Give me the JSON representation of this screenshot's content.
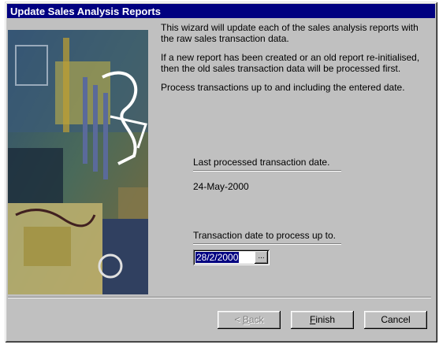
{
  "window": {
    "title": "Update Sales Analysis Reports"
  },
  "intro": {
    "paragraph_1": "This wizard will update each of the sales analysis reports with the raw sales transaction data.",
    "paragraph_2": "If a new report has been created or an old report re-initialised, then the old sales transaction data will be processed first.",
    "paragraph_3": "Process transactions up to and including the entered date."
  },
  "last_processed": {
    "label": "Last processed transaction date.",
    "value": "24-May-2000"
  },
  "process_up_to": {
    "label": "Transaction date to process up to.",
    "value": "28/2/2000",
    "picker_label": "..."
  },
  "buttons": {
    "back_prefix": "< ",
    "back_accel": "B",
    "back_rest": "ack",
    "finish_accel": "F",
    "finish_rest": "inish",
    "cancel": "Cancel"
  },
  "colors": {
    "title_bar": "#000080",
    "dialog_face": "#c0c0c0",
    "selection": "#000080"
  }
}
